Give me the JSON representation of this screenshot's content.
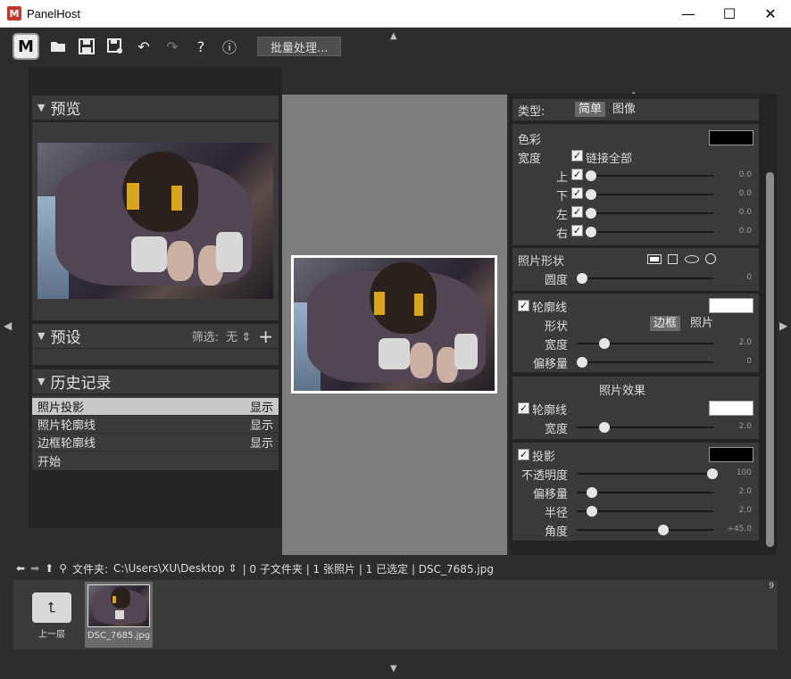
{
  "window": {
    "app_icon": "M",
    "title": "PanelHost",
    "minimize": "—",
    "maximize": "☐",
    "close": "✕"
  },
  "toolbar": {
    "logo": "M",
    "batch_label": "批量处理...",
    "icons": [
      "open-folder-icon",
      "save-icon",
      "save-as-icon",
      "undo-icon",
      "redo-icon",
      "help-icon",
      "info-icon"
    ]
  },
  "left": {
    "preview_title": "预览",
    "presets_title": "预设",
    "presets_filter_label": "筛选:",
    "presets_filter_value": "无",
    "history_title": "历史记录",
    "history": [
      {
        "label": "照片投影",
        "action": "显示"
      },
      {
        "label": "照片轮廓线",
        "action": "显示"
      },
      {
        "label": "边框轮廓线",
        "action": "显示"
      },
      {
        "label": "开始",
        "action": ""
      }
    ]
  },
  "right": {
    "type_label": "类型:",
    "type_simple": "简单",
    "type_image": "图像",
    "color_label": "色彩",
    "width_label": "宽度",
    "link_all_label": "链接全部",
    "sides": [
      {
        "label": "上",
        "value": "0.0"
      },
      {
        "label": "下",
        "value": "0.0"
      },
      {
        "label": "左",
        "value": "0.0"
      },
      {
        "label": "右",
        "value": "0.0"
      }
    ],
    "shape_label": "照片形状",
    "roundness_label": "圆度",
    "roundness_value": "0",
    "outline_label": "轮廓线",
    "shape_sub_label": "形状",
    "shape_border": "边框",
    "shape_photo": "照片",
    "outline_width_label": "宽度",
    "outline_width_value": "2.0",
    "offset_label": "偏移量",
    "offset_value": "0",
    "photo_effect_title": "照片效果",
    "effect_outline_label": "轮廓线",
    "effect_width_label": "宽度",
    "effect_width_value": "2.0",
    "shadow_label": "投影",
    "opacity_label": "不透明度",
    "opacity_value": "100",
    "shadow_offset_label": "偏移量",
    "shadow_offset_value": "2.0",
    "radius_label": "半径",
    "radius_value": "2.0",
    "angle_label": "角度",
    "angle_value": "+45.0",
    "colors": {
      "border": "#000000",
      "outline": "#ffffff",
      "effect_outline": "#ffffff",
      "shadow": "#000000"
    },
    "slider_levels": {
      "sides": [
        0,
        0,
        0,
        0
      ],
      "roundness": 0,
      "outline_width": 0.2,
      "offset": 0,
      "effect_width": 0.2,
      "opacity": 1.0,
      "shadow_offset": 0.1,
      "radius": 0.1,
      "angle": 0.63
    }
  },
  "pathbar": {
    "folder_label": "文件夹:",
    "path": "C:\\Users\\XU\\Desktop",
    "info": "| 0 子文件夹 | 1 张照片 | 1 已选定 | DSC_7685.jpg"
  },
  "filmstrip": {
    "up_label": "上一层",
    "file_label": "DSC_7685.jpg",
    "count": "9"
  }
}
